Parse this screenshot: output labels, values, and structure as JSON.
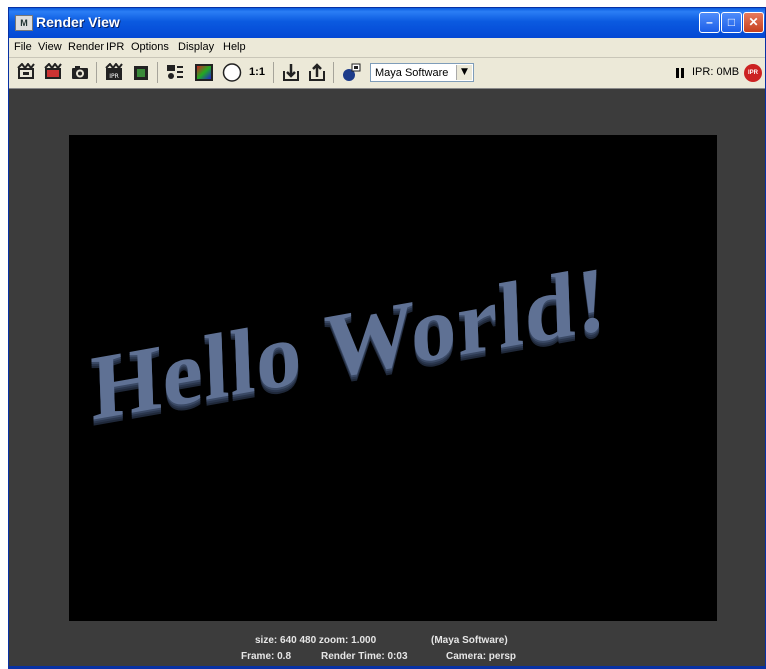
{
  "window": {
    "title": "Render View",
    "title_icon": "M",
    "buttons": {
      "minimize": "–",
      "maximize": "□",
      "close": "✕"
    }
  },
  "menu": [
    "File",
    "View",
    "Render",
    "IPR",
    "Options",
    "Display",
    "Help"
  ],
  "toolbar": {
    "icons": [
      "redo-render-icon",
      "render-region-icon",
      "snapshot-icon",
      "ipr-render-icon",
      "refresh-ipr-icon",
      "render-settings-icon",
      "rgb-channels-icon",
      "alpha-channel-icon",
      "one-to-one-icon",
      "keep-image-icon",
      "remove-image-icon",
      "render-globals-icon"
    ],
    "one_to_one_label": "1:1",
    "renderer": "Maya Software",
    "ipr_memory": "IPR: 0MB",
    "ipr_stop_label": "IPR"
  },
  "render": {
    "text": "Hello World!",
    "text_color": "#5f7194",
    "background": "#000000"
  },
  "status": {
    "size": "size:  640  480 zoom: 1.000",
    "renderer": "(Maya Software)",
    "frame": "Frame: 0.8",
    "render_time": "Render Time: 0:03",
    "camera": "Camera: persp"
  },
  "colors": {
    "title_blue": "#0a5bde",
    "panel": "#3c3c3c",
    "menu_bg": "#ece9d8"
  }
}
